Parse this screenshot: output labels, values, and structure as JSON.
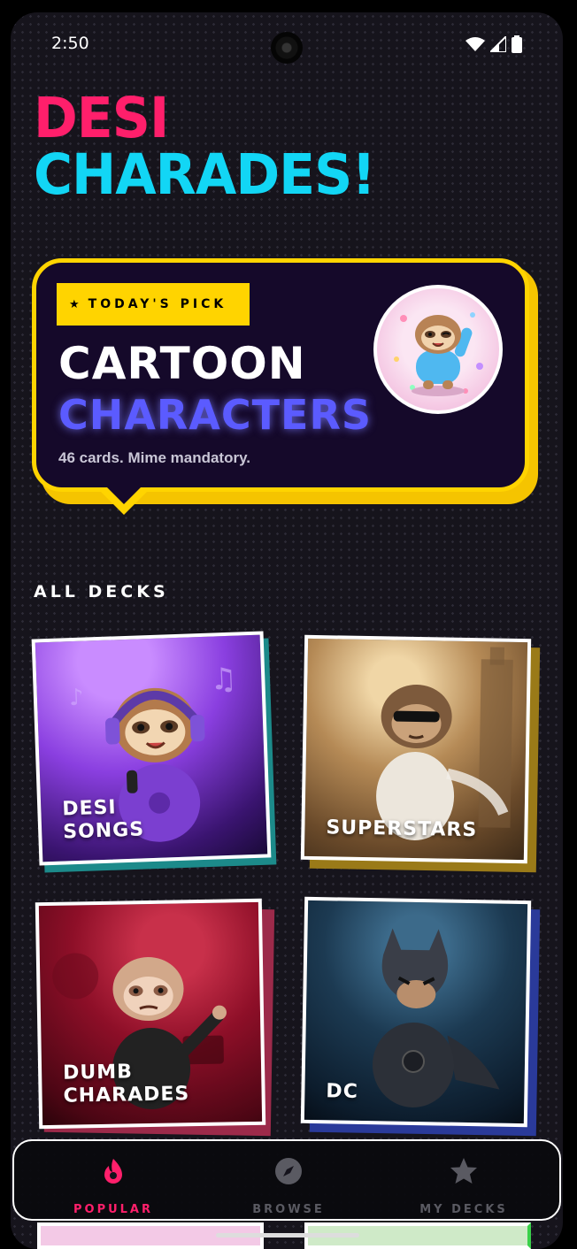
{
  "status": {
    "time": "2:50"
  },
  "title": {
    "line1": "DESI",
    "line2": "CHARADES!"
  },
  "todays_pick": {
    "badge": "TODAY'S PICK",
    "title_line1": "CARTOON",
    "title_line2": "CHARACTERS",
    "subtitle": "46 cards. Mime mandatory."
  },
  "section_heading": "ALL DECKS",
  "decks": [
    {
      "label_line1": "DESI",
      "label_line2": "SONGS"
    },
    {
      "label_line1": "SUPERSTARS",
      "label_line2": ""
    },
    {
      "label_line1": "DUMB",
      "label_line2": "CHARADES"
    },
    {
      "label_line1": "DC",
      "label_line2": ""
    }
  ],
  "nav": [
    {
      "label": "POPULAR",
      "icon": "flame-icon",
      "active": true
    },
    {
      "label": "BROWSE",
      "icon": "compass-icon",
      "active": false
    },
    {
      "label": "MY DECKS",
      "icon": "star-icon",
      "active": false
    }
  ],
  "colors": {
    "pink": "#ff1f6b",
    "cyan": "#12d6f5",
    "yellow": "#ffd400",
    "indigo": "#5b5bff"
  }
}
